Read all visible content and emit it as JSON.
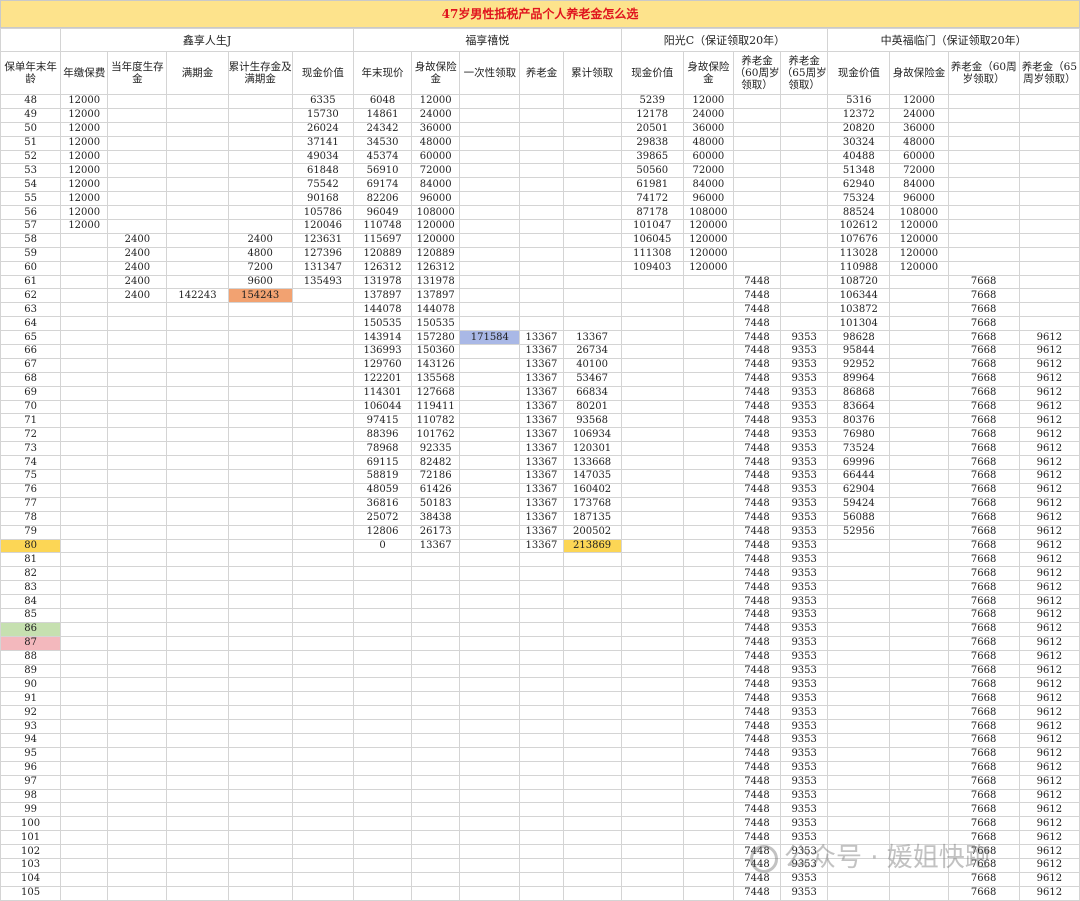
{
  "title": "47岁男性抵税产品个人养老金怎么选",
  "watermark": "公众号 · 媛姐快跑",
  "watermark_icon": "wechat-logo-icon",
  "highlight_colors": {
    "orange": "#f2a271",
    "blue": "#a9b8e6",
    "yellow": "#fcd655",
    "green": "#c6e0b0",
    "pink": "#f3b8bd"
  },
  "groups": [
    {
      "label": "",
      "span": 1
    },
    {
      "label": "鑫享人生J",
      "span": 5
    },
    {
      "label": "福享禧悦",
      "span": 5
    },
    {
      "label": "阳光C（保证领取20年）",
      "span": 4
    },
    {
      "label": "中英福临门（保证领取20年）",
      "span": 4
    }
  ],
  "columns": [
    "保单年末年龄",
    "年缴保费",
    "当年度生存金",
    "满期金",
    "累计生存金及满期金",
    "现金价值",
    "年末现价",
    "身故保险金",
    "一次性领取",
    "养老金",
    "累计领取",
    "现金价值",
    "身故保险金",
    "养老金（60周岁领取）",
    "养老金（65周岁领取）",
    "现金价值",
    "身故保险金",
    "养老金（60周岁领取）",
    "养老金（65周岁领取）"
  ],
  "rows": [
    [
      "48",
      "12000",
      "",
      "",
      "",
      "6335",
      "6048",
      "12000",
      "",
      "",
      "",
      "5239",
      "12000",
      "",
      "",
      "5316",
      "12000",
      "",
      ""
    ],
    [
      "49",
      "12000",
      "",
      "",
      "",
      "15730",
      "14861",
      "24000",
      "",
      "",
      "",
      "12178",
      "24000",
      "",
      "",
      "12372",
      "24000",
      "",
      ""
    ],
    [
      "50",
      "12000",
      "",
      "",
      "",
      "26024",
      "24342",
      "36000",
      "",
      "",
      "",
      "20501",
      "36000",
      "",
      "",
      "20820",
      "36000",
      "",
      ""
    ],
    [
      "51",
      "12000",
      "",
      "",
      "",
      "37141",
      "34530",
      "48000",
      "",
      "",
      "",
      "29838",
      "48000",
      "",
      "",
      "30324",
      "48000",
      "",
      ""
    ],
    [
      "52",
      "12000",
      "",
      "",
      "",
      "49034",
      "45374",
      "60000",
      "",
      "",
      "",
      "39865",
      "60000",
      "",
      "",
      "40488",
      "60000",
      "",
      ""
    ],
    [
      "53",
      "12000",
      "",
      "",
      "",
      "61848",
      "56910",
      "72000",
      "",
      "",
      "",
      "50560",
      "72000",
      "",
      "",
      "51348",
      "72000",
      "",
      ""
    ],
    [
      "54",
      "12000",
      "",
      "",
      "",
      "75542",
      "69174",
      "84000",
      "",
      "",
      "",
      "61981",
      "84000",
      "",
      "",
      "62940",
      "84000",
      "",
      ""
    ],
    [
      "55",
      "12000",
      "",
      "",
      "",
      "90168",
      "82206",
      "96000",
      "",
      "",
      "",
      "74172",
      "96000",
      "",
      "",
      "75324",
      "96000",
      "",
      ""
    ],
    [
      "56",
      "12000",
      "",
      "",
      "",
      "105786",
      "96049",
      "108000",
      "",
      "",
      "",
      "87178",
      "108000",
      "",
      "",
      "88524",
      "108000",
      "",
      ""
    ],
    [
      "57",
      "12000",
      "",
      "",
      "",
      "120046",
      "110748",
      "120000",
      "",
      "",
      "",
      "101047",
      "120000",
      "",
      "",
      "102612",
      "120000",
      "",
      ""
    ],
    [
      "58",
      "",
      "2400",
      "",
      "2400",
      "123631",
      "115697",
      "120000",
      "",
      "",
      "",
      "106045",
      "120000",
      "",
      "",
      "107676",
      "120000",
      "",
      ""
    ],
    [
      "59",
      "",
      "2400",
      "",
      "4800",
      "127396",
      "120889",
      "120889",
      "",
      "",
      "",
      "111308",
      "120000",
      "",
      "",
      "113028",
      "120000",
      "",
      ""
    ],
    [
      "60",
      "",
      "2400",
      "",
      "7200",
      "131347",
      "126312",
      "126312",
      "",
      "",
      "",
      "109403",
      "120000",
      "",
      "",
      "110988",
      "120000",
      "",
      ""
    ],
    [
      "61",
      "",
      "2400",
      "",
      "9600",
      "135493",
      "131978",
      "131978",
      "",
      "",
      "",
      "",
      "",
      "7448",
      "",
      "108720",
      "",
      "7668",
      ""
    ],
    [
      "62",
      "",
      "2400",
      "142243",
      "154243",
      "",
      "137897",
      "137897",
      "",
      "",
      "",
      "",
      "",
      "7448",
      "",
      "106344",
      "",
      "7668",
      ""
    ],
    [
      "63",
      "",
      "",
      "",
      "",
      "",
      "144078",
      "144078",
      "",
      "",
      "",
      "",
      "",
      "7448",
      "",
      "103872",
      "",
      "7668",
      ""
    ],
    [
      "64",
      "",
      "",
      "",
      "",
      "",
      "150535",
      "150535",
      "",
      "",
      "",
      "",
      "",
      "7448",
      "",
      "101304",
      "",
      "7668",
      ""
    ],
    [
      "65",
      "",
      "",
      "",
      "",
      "",
      "143914",
      "157280",
      "171584",
      "13367",
      "13367",
      "",
      "",
      "7448",
      "9353",
      "98628",
      "",
      "7668",
      "9612"
    ],
    [
      "66",
      "",
      "",
      "",
      "",
      "",
      "136993",
      "150360",
      "",
      "13367",
      "26734",
      "",
      "",
      "7448",
      "9353",
      "95844",
      "",
      "7668",
      "9612"
    ],
    [
      "67",
      "",
      "",
      "",
      "",
      "",
      "129760",
      "143126",
      "",
      "13367",
      "40100",
      "",
      "",
      "7448",
      "9353",
      "92952",
      "",
      "7668",
      "9612"
    ],
    [
      "68",
      "",
      "",
      "",
      "",
      "",
      "122201",
      "135568",
      "",
      "13367",
      "53467",
      "",
      "",
      "7448",
      "9353",
      "89964",
      "",
      "7668",
      "9612"
    ],
    [
      "69",
      "",
      "",
      "",
      "",
      "",
      "114301",
      "127668",
      "",
      "13367",
      "66834",
      "",
      "",
      "7448",
      "9353",
      "86868",
      "",
      "7668",
      "9612"
    ],
    [
      "70",
      "",
      "",
      "",
      "",
      "",
      "106044",
      "119411",
      "",
      "13367",
      "80201",
      "",
      "",
      "7448",
      "9353",
      "83664",
      "",
      "7668",
      "9612"
    ],
    [
      "71",
      "",
      "",
      "",
      "",
      "",
      "97415",
      "110782",
      "",
      "13367",
      "93568",
      "",
      "",
      "7448",
      "9353",
      "80376",
      "",
      "7668",
      "9612"
    ],
    [
      "72",
      "",
      "",
      "",
      "",
      "",
      "88396",
      "101762",
      "",
      "13367",
      "106934",
      "",
      "",
      "7448",
      "9353",
      "76980",
      "",
      "7668",
      "9612"
    ],
    [
      "73",
      "",
      "",
      "",
      "",
      "",
      "78968",
      "92335",
      "",
      "13367",
      "120301",
      "",
      "",
      "7448",
      "9353",
      "73524",
      "",
      "7668",
      "9612"
    ],
    [
      "74",
      "",
      "",
      "",
      "",
      "",
      "69115",
      "82482",
      "",
      "13367",
      "133668",
      "",
      "",
      "7448",
      "9353",
      "69996",
      "",
      "7668",
      "9612"
    ],
    [
      "75",
      "",
      "",
      "",
      "",
      "",
      "58819",
      "72186",
      "",
      "13367",
      "147035",
      "",
      "",
      "7448",
      "9353",
      "66444",
      "",
      "7668",
      "9612"
    ],
    [
      "76",
      "",
      "",
      "",
      "",
      "",
      "48059",
      "61426",
      "",
      "13367",
      "160402",
      "",
      "",
      "7448",
      "9353",
      "62904",
      "",
      "7668",
      "9612"
    ],
    [
      "77",
      "",
      "",
      "",
      "",
      "",
      "36816",
      "50183",
      "",
      "13367",
      "173768",
      "",
      "",
      "7448",
      "9353",
      "59424",
      "",
      "7668",
      "9612"
    ],
    [
      "78",
      "",
      "",
      "",
      "",
      "",
      "25072",
      "38438",
      "",
      "13367",
      "187135",
      "",
      "",
      "7448",
      "9353",
      "56088",
      "",
      "7668",
      "9612"
    ],
    [
      "79",
      "",
      "",
      "",
      "",
      "",
      "12806",
      "26173",
      "",
      "13367",
      "200502",
      "",
      "",
      "7448",
      "9353",
      "52956",
      "",
      "7668",
      "9612"
    ],
    [
      "80",
      "",
      "",
      "",
      "",
      "",
      "0",
      "13367",
      "",
      "13367",
      "213869",
      "",
      "",
      "7448",
      "9353",
      "",
      "",
      "7668",
      "9612"
    ],
    [
      "81",
      "",
      "",
      "",
      "",
      "",
      "",
      "",
      "",
      "",
      "",
      "",
      "",
      "7448",
      "9353",
      "",
      "",
      "7668",
      "9612"
    ],
    [
      "82",
      "",
      "",
      "",
      "",
      "",
      "",
      "",
      "",
      "",
      "",
      "",
      "",
      "7448",
      "9353",
      "",
      "",
      "7668",
      "9612"
    ],
    [
      "83",
      "",
      "",
      "",
      "",
      "",
      "",
      "",
      "",
      "",
      "",
      "",
      "",
      "7448",
      "9353",
      "",
      "",
      "7668",
      "9612"
    ],
    [
      "84",
      "",
      "",
      "",
      "",
      "",
      "",
      "",
      "",
      "",
      "",
      "",
      "",
      "7448",
      "9353",
      "",
      "",
      "7668",
      "9612"
    ],
    [
      "85",
      "",
      "",
      "",
      "",
      "",
      "",
      "",
      "",
      "",
      "",
      "",
      "",
      "7448",
      "9353",
      "",
      "",
      "7668",
      "9612"
    ],
    [
      "86",
      "",
      "",
      "",
      "",
      "",
      "",
      "",
      "",
      "",
      "",
      "",
      "",
      "7448",
      "9353",
      "",
      "",
      "7668",
      "9612"
    ],
    [
      "87",
      "",
      "",
      "",
      "",
      "",
      "",
      "",
      "",
      "",
      "",
      "",
      "",
      "7448",
      "9353",
      "",
      "",
      "7668",
      "9612"
    ],
    [
      "88",
      "",
      "",
      "",
      "",
      "",
      "",
      "",
      "",
      "",
      "",
      "",
      "",
      "7448",
      "9353",
      "",
      "",
      "7668",
      "9612"
    ],
    [
      "89",
      "",
      "",
      "",
      "",
      "",
      "",
      "",
      "",
      "",
      "",
      "",
      "",
      "7448",
      "9353",
      "",
      "",
      "7668",
      "9612"
    ],
    [
      "90",
      "",
      "",
      "",
      "",
      "",
      "",
      "",
      "",
      "",
      "",
      "",
      "",
      "7448",
      "9353",
      "",
      "",
      "7668",
      "9612"
    ],
    [
      "91",
      "",
      "",
      "",
      "",
      "",
      "",
      "",
      "",
      "",
      "",
      "",
      "",
      "7448",
      "9353",
      "",
      "",
      "7668",
      "9612"
    ],
    [
      "92",
      "",
      "",
      "",
      "",
      "",
      "",
      "",
      "",
      "",
      "",
      "",
      "",
      "7448",
      "9353",
      "",
      "",
      "7668",
      "9612"
    ],
    [
      "93",
      "",
      "",
      "",
      "",
      "",
      "",
      "",
      "",
      "",
      "",
      "",
      "",
      "7448",
      "9353",
      "",
      "",
      "7668",
      "9612"
    ],
    [
      "94",
      "",
      "",
      "",
      "",
      "",
      "",
      "",
      "",
      "",
      "",
      "",
      "",
      "7448",
      "9353",
      "",
      "",
      "7668",
      "9612"
    ],
    [
      "95",
      "",
      "",
      "",
      "",
      "",
      "",
      "",
      "",
      "",
      "",
      "",
      "",
      "7448",
      "9353",
      "",
      "",
      "7668",
      "9612"
    ],
    [
      "96",
      "",
      "",
      "",
      "",
      "",
      "",
      "",
      "",
      "",
      "",
      "",
      "",
      "7448",
      "9353",
      "",
      "",
      "7668",
      "9612"
    ],
    [
      "97",
      "",
      "",
      "",
      "",
      "",
      "",
      "",
      "",
      "",
      "",
      "",
      "",
      "7448",
      "9353",
      "",
      "",
      "7668",
      "9612"
    ],
    [
      "98",
      "",
      "",
      "",
      "",
      "",
      "",
      "",
      "",
      "",
      "",
      "",
      "",
      "7448",
      "9353",
      "",
      "",
      "7668",
      "9612"
    ],
    [
      "99",
      "",
      "",
      "",
      "",
      "",
      "",
      "",
      "",
      "",
      "",
      "",
      "",
      "7448",
      "9353",
      "",
      "",
      "7668",
      "9612"
    ],
    [
      "100",
      "",
      "",
      "",
      "",
      "",
      "",
      "",
      "",
      "",
      "",
      "",
      "",
      "7448",
      "9353",
      "",
      "",
      "7668",
      "9612"
    ],
    [
      "101",
      "",
      "",
      "",
      "",
      "",
      "",
      "",
      "",
      "",
      "",
      "",
      "",
      "7448",
      "9353",
      "",
      "",
      "7668",
      "9612"
    ],
    [
      "102",
      "",
      "",
      "",
      "",
      "",
      "",
      "",
      "",
      "",
      "",
      "",
      "",
      "7448",
      "9353",
      "",
      "",
      "7668",
      "9612"
    ],
    [
      "103",
      "",
      "",
      "",
      "",
      "",
      "",
      "",
      "",
      "",
      "",
      "",
      "",
      "7448",
      "9353",
      "",
      "",
      "7668",
      "9612"
    ],
    [
      "104",
      "",
      "",
      "",
      "",
      "",
      "",
      "",
      "",
      "",
      "",
      "",
      "",
      "7448",
      "9353",
      "",
      "",
      "7668",
      "9612"
    ],
    [
      "105",
      "",
      "",
      "",
      "",
      "",
      "",
      "",
      "",
      "",
      "",
      "",
      "",
      "7448",
      "9353",
      "",
      "",
      "7668",
      "9612"
    ]
  ],
  "highlights": [
    {
      "row": 14,
      "col": 4,
      "color": "orange"
    },
    {
      "row": 17,
      "col": 8,
      "color": "blue"
    },
    {
      "row": 32,
      "col": 0,
      "color": "yellow"
    },
    {
      "row": 32,
      "col": 10,
      "color": "yellow"
    },
    {
      "row": 38,
      "col": 0,
      "color": "green"
    },
    {
      "row": 39,
      "col": 0,
      "color": "pink"
    }
  ]
}
